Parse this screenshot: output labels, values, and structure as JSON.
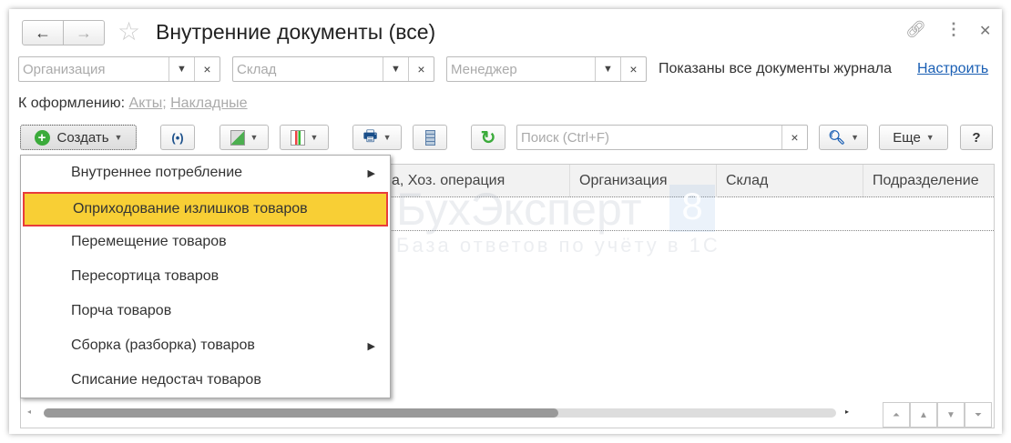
{
  "header": {
    "title": "Внутренние документы (все)",
    "back": "←",
    "forward": "→"
  },
  "filters": {
    "organization_placeholder": "Организация",
    "warehouse_placeholder": "Склад",
    "manager_placeholder": "Менеджер",
    "status_text": "Показаны все документы журнала",
    "configure_link": "Настроить"
  },
  "to_process": {
    "label": "К оформлению:",
    "links": [
      "Акты",
      "Накладные"
    ],
    "separator": ";"
  },
  "toolbar": {
    "create_label": "Создать",
    "search_placeholder": "Поиск (Ctrl+F)",
    "more_label": "Еще",
    "help_label": "?"
  },
  "table": {
    "columns": [
      "а, Хоз. операция",
      "Организация",
      "Склад",
      "Подразделение"
    ]
  },
  "menu": {
    "items": [
      {
        "label": "Внутреннее потребление",
        "submenu": true
      },
      {
        "label": "Оприходование излишков товаров",
        "selected": true
      },
      {
        "label": "Перемещение товаров"
      },
      {
        "label": "Пересортица товаров"
      },
      {
        "label": "Порча товаров"
      },
      {
        "label": "Сборка (разборка) товаров",
        "submenu": true
      },
      {
        "label": "Списание недостач товаров"
      }
    ]
  },
  "watermark": {
    "brand": "БухЭксперт",
    "badge": "8",
    "tagline": "База ответов по учёту в 1С"
  },
  "colors": {
    "link": "#1a5fb4",
    "highlight": "#f8cf35",
    "highlight_border": "#e83c3c",
    "green": "#3bab3b"
  }
}
